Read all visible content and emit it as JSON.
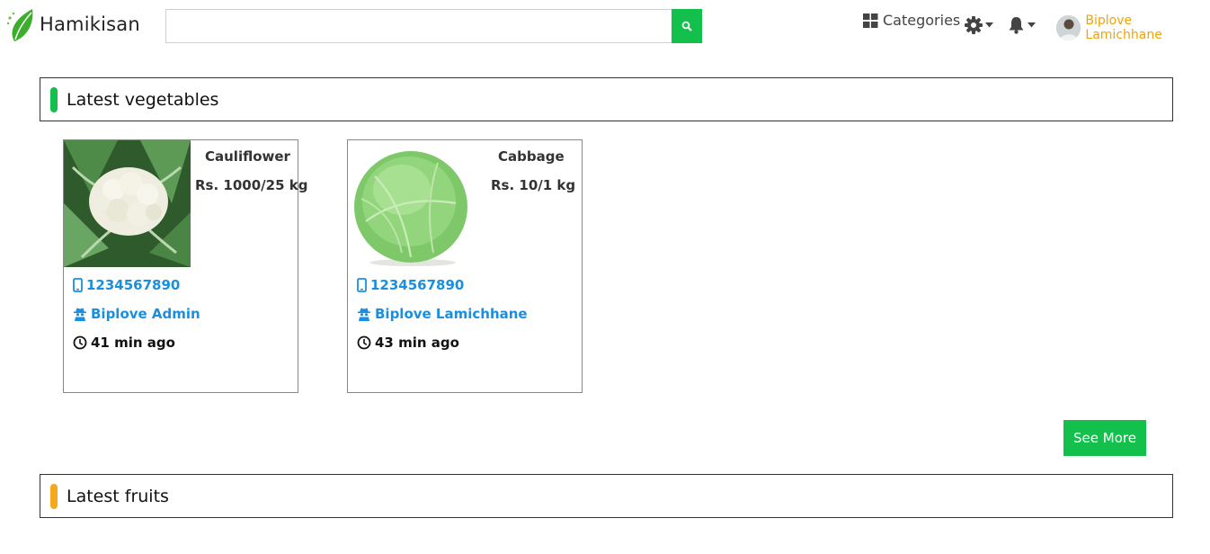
{
  "app": {
    "brand": "Hamikisan",
    "accent": "#13c04b",
    "link_color": "#1a8fe0",
    "user_color": "#f0a30a"
  },
  "navbar": {
    "search": {
      "value": "",
      "placeholder": ""
    },
    "categories_label": "Categories",
    "user_name": "Biplove Lamichhane"
  },
  "sections": {
    "vegetables": {
      "title": "Latest vegetables",
      "bar_color": "#13c04b"
    },
    "fruits": {
      "title": "Latest fruits",
      "bar_color": "#f5a81c"
    }
  },
  "products": [
    {
      "name": "Cauliflower",
      "price": "Rs. 1000/25 kg",
      "phone": "1234567890",
      "seller": "Biplove Admin",
      "time": "41 min ago"
    },
    {
      "name": "Cabbage",
      "price": "Rs. 10/1 kg",
      "phone": "1234567890",
      "seller": "Biplove Lamichhane",
      "time": "43 min ago"
    }
  ],
  "see_more_label": "See More"
}
